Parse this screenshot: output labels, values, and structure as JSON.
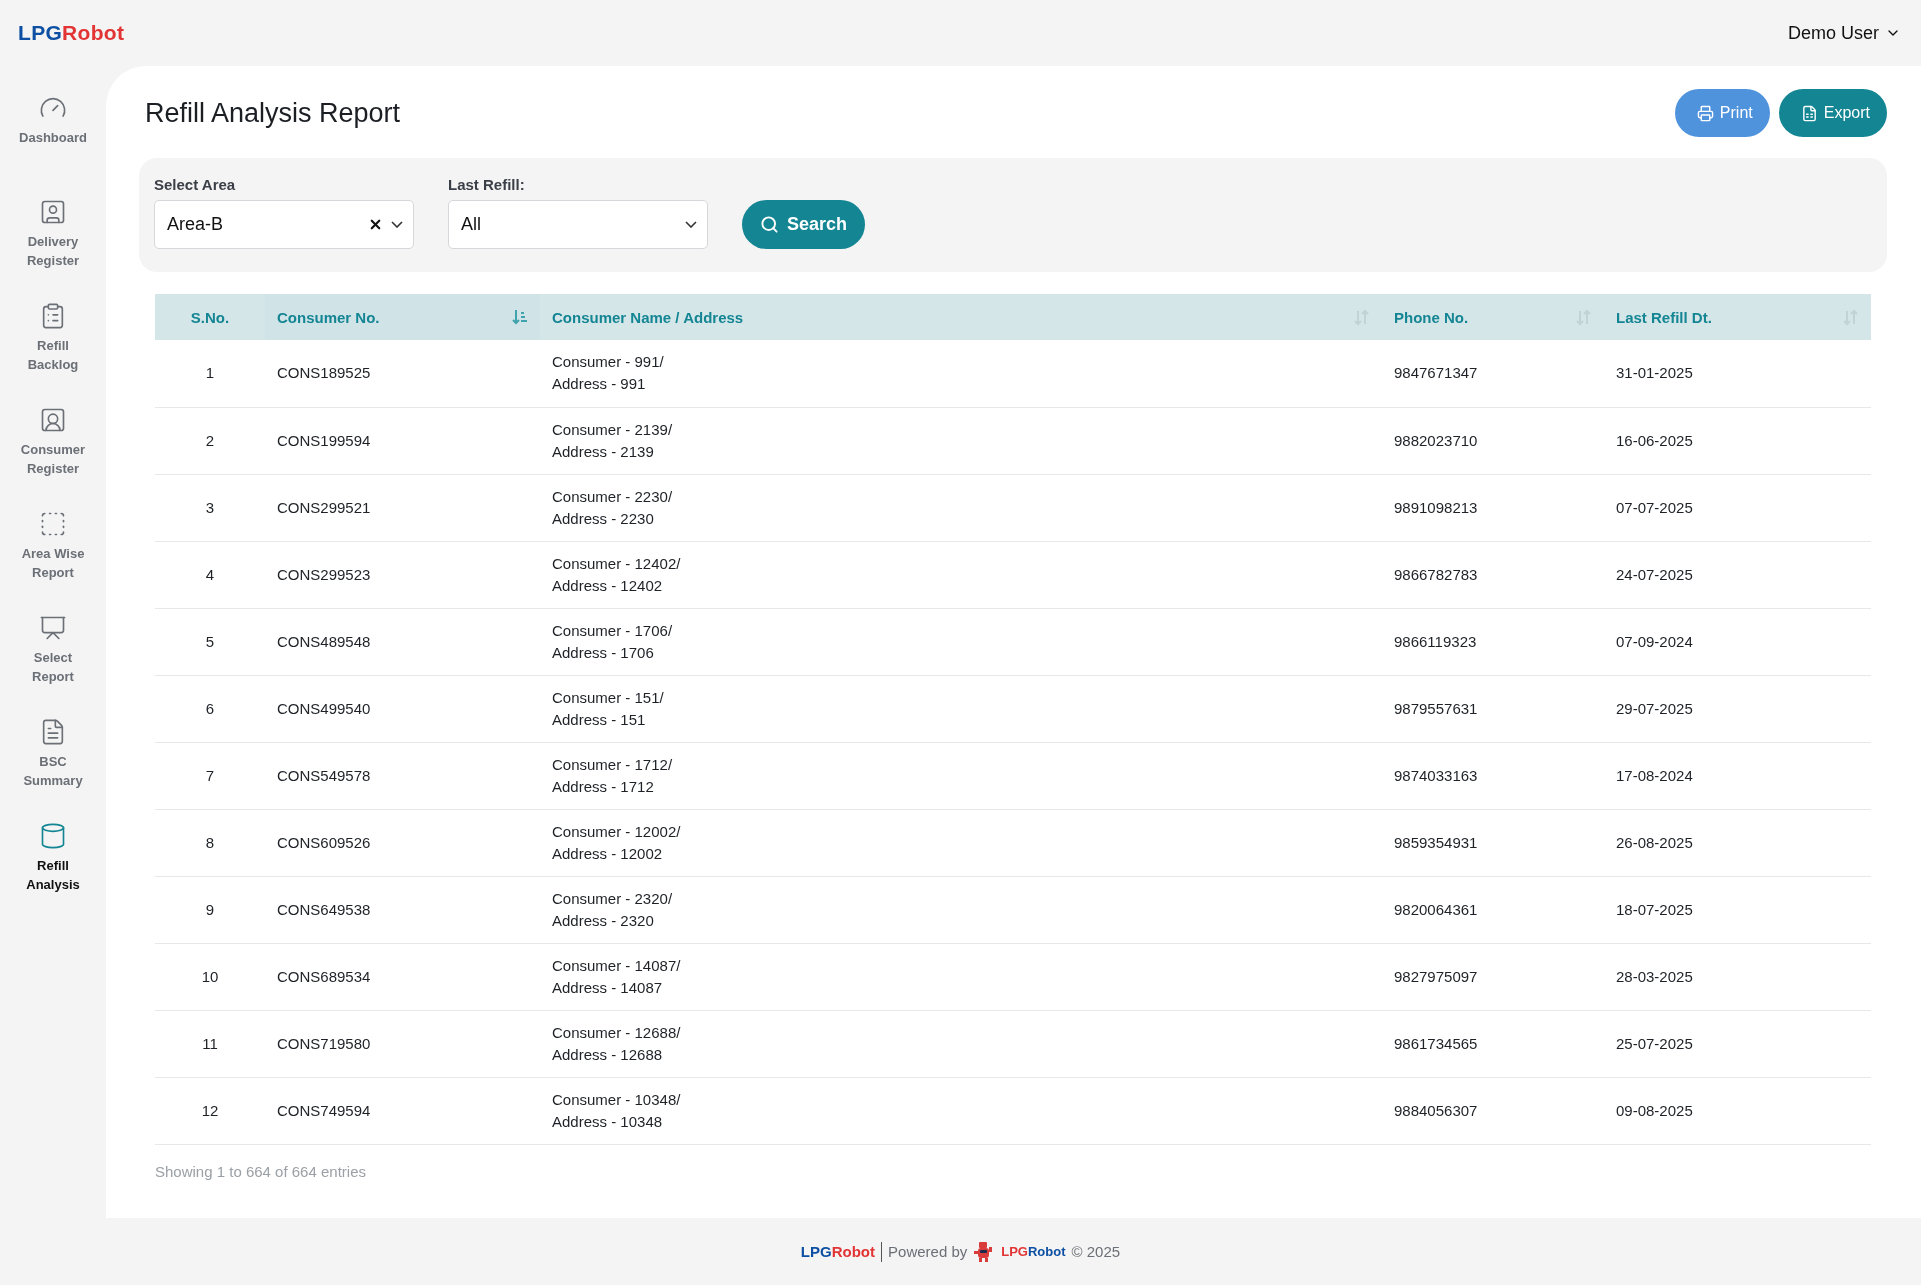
{
  "header": {
    "logo": {
      "prefix": "LPG",
      "suffix": "Robot"
    },
    "user": "Demo User"
  },
  "sidebar": {
    "items": [
      {
        "label": "Dashboard",
        "selected": false
      },
      {
        "label": "Delivery Register",
        "selected": false
      },
      {
        "label": "Refill Backlog",
        "selected": false
      },
      {
        "label": "Consumer Register",
        "selected": false
      },
      {
        "label": "Area Wise Report",
        "selected": false
      },
      {
        "label": "Select Report",
        "selected": false
      },
      {
        "label": "BSC Summary",
        "selected": false
      },
      {
        "label": "Refill Analysis",
        "selected": true
      }
    ]
  },
  "page": {
    "title": "Refill Analysis Report",
    "buttons": [
      {
        "kind": "print",
        "label": "Print"
      },
      {
        "kind": "export",
        "label": "Export"
      }
    ]
  },
  "filters": {
    "area": {
      "label": "Select Area",
      "value": "Area-B"
    },
    "last_refill": {
      "label": "Last Refill:",
      "value": "All"
    },
    "search_button": "Search"
  },
  "table": {
    "columns": [
      {
        "label": "S.No.",
        "sortable": false
      },
      {
        "label": "Consumer No.",
        "sortable": true,
        "sort_active": true
      },
      {
        "label": "Consumer Name / Address",
        "sortable": true,
        "sort_active": false
      },
      {
        "label": "Phone No.",
        "sortable": true,
        "sort_active": false
      },
      {
        "label": "Last Refill Dt.",
        "sortable": true,
        "sort_active": false
      }
    ],
    "rows": [
      {
        "sno": "1",
        "consumer_no": "CONS189525",
        "name": "Consumer - 991/",
        "address": "Address - 991",
        "phone": "9847671347",
        "last_refill": "31-01-2025"
      },
      {
        "sno": "2",
        "consumer_no": "CONS199594",
        "name": "Consumer - 2139/",
        "address": "Address - 2139",
        "phone": "9882023710",
        "last_refill": "16-06-2025"
      },
      {
        "sno": "3",
        "consumer_no": "CONS299521",
        "name": "Consumer - 2230/",
        "address": "Address - 2230",
        "phone": "9891098213",
        "last_refill": "07-07-2025"
      },
      {
        "sno": "4",
        "consumer_no": "CONS299523",
        "name": "Consumer - 12402/",
        "address": "Address - 12402",
        "phone": "9866782783",
        "last_refill": "24-07-2025"
      },
      {
        "sno": "5",
        "consumer_no": "CONS489548",
        "name": "Consumer - 1706/",
        "address": "Address - 1706",
        "phone": "9866119323",
        "last_refill": "07-09-2024"
      },
      {
        "sno": "6",
        "consumer_no": "CONS499540",
        "name": "Consumer - 151/",
        "address": "Address - 151",
        "phone": "9879557631",
        "last_refill": "29-07-2025"
      },
      {
        "sno": "7",
        "consumer_no": "CONS549578",
        "name": "Consumer - 1712/",
        "address": "Address - 1712",
        "phone": "9874033163",
        "last_refill": "17-08-2024"
      },
      {
        "sno": "8",
        "consumer_no": "CONS609526",
        "name": "Consumer - 12002/",
        "address": "Address - 12002",
        "phone": "9859354931",
        "last_refill": "26-08-2025"
      },
      {
        "sno": "9",
        "consumer_no": "CONS649538",
        "name": "Consumer - 2320/",
        "address": "Address - 2320",
        "phone": "9820064361",
        "last_refill": "18-07-2025"
      },
      {
        "sno": "10",
        "consumer_no": "CONS689534",
        "name": "Consumer - 14087/",
        "address": "Address - 14087",
        "phone": "9827975097",
        "last_refill": "28-03-2025"
      },
      {
        "sno": "11",
        "consumer_no": "CONS719580",
        "name": "Consumer - 12688/",
        "address": "Address - 12688",
        "phone": "9861734565",
        "last_refill": "25-07-2025"
      },
      {
        "sno": "12",
        "consumer_no": "CONS749594",
        "name": "Consumer - 10348/",
        "address": "Address - 10348",
        "phone": "9884056307",
        "last_refill": "09-08-2025"
      }
    ],
    "info": "Showing 1 to 664 of 664 entries"
  },
  "footer": {
    "brand": {
      "prefix": "LPG",
      "suffix": "Robot"
    },
    "powered_by": "Powered by",
    "powered_brand": {
      "prefix": "LPG",
      "suffix": "Robot"
    },
    "copyright": "© 2025"
  }
}
